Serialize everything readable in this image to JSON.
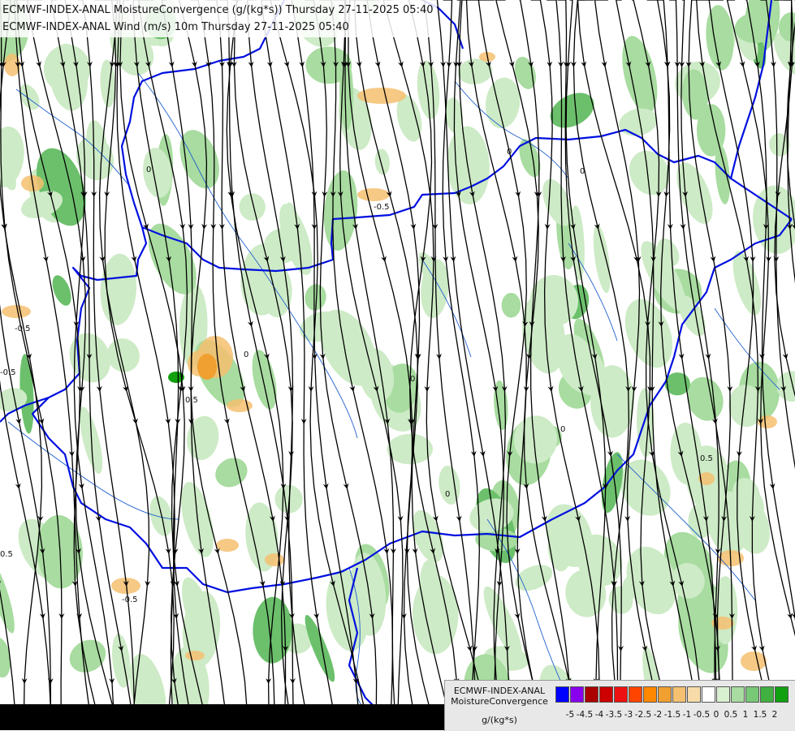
{
  "titles": {
    "line1": "ECMWF-INDEX-ANAL MoistureConvergence (g/(kg*s)) Thursday 27-11-2025 05:40",
    "line2": "ECMWF-INDEX-ANAL Wind (m/s) 10m Thursday 27-11-2025 05:40"
  },
  "legend": {
    "source": "ECMWF-INDEX-ANAL",
    "parameter": "MoistureConvergence",
    "unit": "g/(kg*s)",
    "colors": [
      "#0000ff",
      "#8800ee",
      "#aa0000",
      "#cc0000",
      "#ee1111",
      "#ff4400",
      "#ff8800",
      "#f0a030",
      "#f5c070",
      "#f7dcaa",
      "#ffffff",
      "#d8f0d0",
      "#a8dca0",
      "#78c878",
      "#40b040",
      "#10a010"
    ],
    "ticks": [
      "-5",
      "-4.5",
      "-4",
      "-3.5",
      "-3",
      "-2.5",
      "-2",
      "-1.5",
      "-1",
      "-0.5",
      "0",
      "0.5",
      "1",
      "1.5",
      "2"
    ]
  },
  "contour_labels": [
    "-0.5",
    "0.5",
    "0",
    "-0.5",
    "0",
    "0.5",
    "-0.5",
    "0",
    "0",
    "0",
    "-0.5",
    "0.5",
    "0",
    "0"
  ]
}
